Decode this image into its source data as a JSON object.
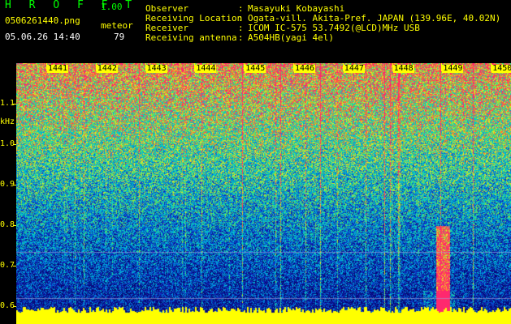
{
  "app": {
    "name": "H R O F F T",
    "version": "1.00",
    "filename": "0506261440.png",
    "datetime": "05.06.26 14:40",
    "count_label": "meteor",
    "count_value": "79"
  },
  "info": [
    {
      "label": "Observer",
      "sep": ":",
      "value": "Masayuki Kobayashi"
    },
    {
      "label": "Receiving Location",
      "sep": ":",
      "value": "Ogata-vill. Akita-Pref. JAPAN (139.96E, 40.02N)"
    },
    {
      "label": "Receiver",
      "sep": ":",
      "value": "ICOM IC-575 53.7492(@LCD)MHz USB"
    },
    {
      "label": "Receiving antenna",
      "sep": ":",
      "value": "A504HB(yagi 4el)"
    }
  ],
  "axis": {
    "unit": "kHz",
    "y_ticks": [
      "1.1",
      "1.0",
      "0.9",
      "0.8",
      "0.7",
      "0.6"
    ],
    "minutes": [
      "1441",
      "1442",
      "1443",
      "1444",
      "1445",
      "1446",
      "1447",
      "1448",
      "1449",
      "1450"
    ]
  },
  "colors": {
    "background": "#000000",
    "label_green": "#00ff00",
    "label_yellow": "#ffff00",
    "noise_low": "#0a0a8c",
    "noise_high": "#00e0e0",
    "meteor_echo": "#ff2a6a"
  }
}
